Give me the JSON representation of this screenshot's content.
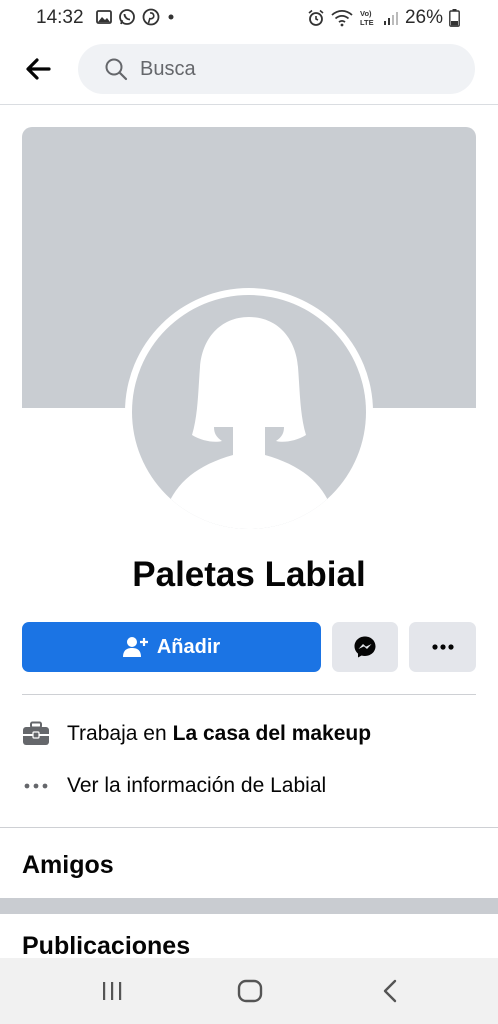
{
  "status_bar": {
    "time": "14:32",
    "battery": "26%"
  },
  "search": {
    "placeholder": "Busca"
  },
  "profile": {
    "name": "Paletas Labial"
  },
  "actions": {
    "add_label": "Añadir"
  },
  "info": {
    "work_prefix": "Trabaja en",
    "work_place": "La casa del makeup",
    "about_label": "Ver la información de Labial"
  },
  "sections": {
    "friends": "Amigos",
    "posts": "Publicaciones"
  },
  "colors": {
    "accent": "#1b74e4",
    "placeholder_gray": "#c9cdd2",
    "button_gray": "#e4e6eb"
  }
}
